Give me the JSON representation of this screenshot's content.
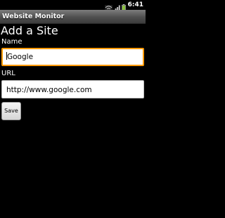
{
  "status_bar": {
    "time": "6:41",
    "icons": [
      "wifi-icon",
      "signal-icon",
      "battery-icon"
    ]
  },
  "title_bar": {
    "title": "Website Monitor"
  },
  "form": {
    "heading": "Add a Site",
    "name_label": "Name",
    "name_value": "Google",
    "url_label": "URL",
    "url_value": "http://www.google.com",
    "save_label": "Save"
  },
  "colors": {
    "focus_border": "#ff9a00",
    "background": "#000000",
    "battery_accent": "#8cc63e"
  }
}
